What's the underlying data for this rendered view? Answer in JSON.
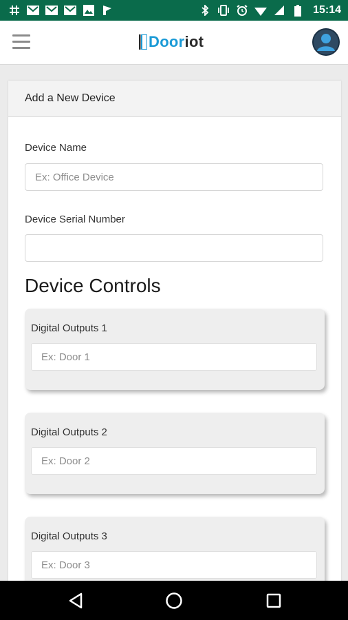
{
  "status_bar": {
    "left_icons": [
      "slack-icon",
      "mail-icon",
      "mail-icon",
      "mail-icon",
      "image-icon",
      "flag-icon"
    ],
    "right_icons": [
      "bluetooth-icon",
      "vibrate-icon",
      "alarm-icon",
      "wifi-icon",
      "signal-icon",
      "battery-icon"
    ],
    "time": "15:14",
    "background": "#0a6b4b"
  },
  "app_bar": {
    "logo_part1": "Door",
    "logo_part2": "iot",
    "logo_color": "#1a9ad6"
  },
  "form": {
    "title": "Add a New Device",
    "device_name_label": "Device Name",
    "device_name_placeholder": "Ex: Office Device",
    "device_name_value": "",
    "serial_label": "Device Serial Number",
    "serial_placeholder": "",
    "serial_value": ""
  },
  "controls": {
    "title": "Device Controls",
    "items": [
      {
        "label": "Digital Outputs 1",
        "placeholder": "Ex: Door 1"
      },
      {
        "label": "Digital Outputs 2",
        "placeholder": "Ex: Door 2"
      },
      {
        "label": "Digital Outputs 3",
        "placeholder": "Ex: Door 3"
      }
    ]
  },
  "nav_bar": {
    "buttons": [
      "back-icon",
      "home-icon",
      "recents-icon"
    ]
  }
}
